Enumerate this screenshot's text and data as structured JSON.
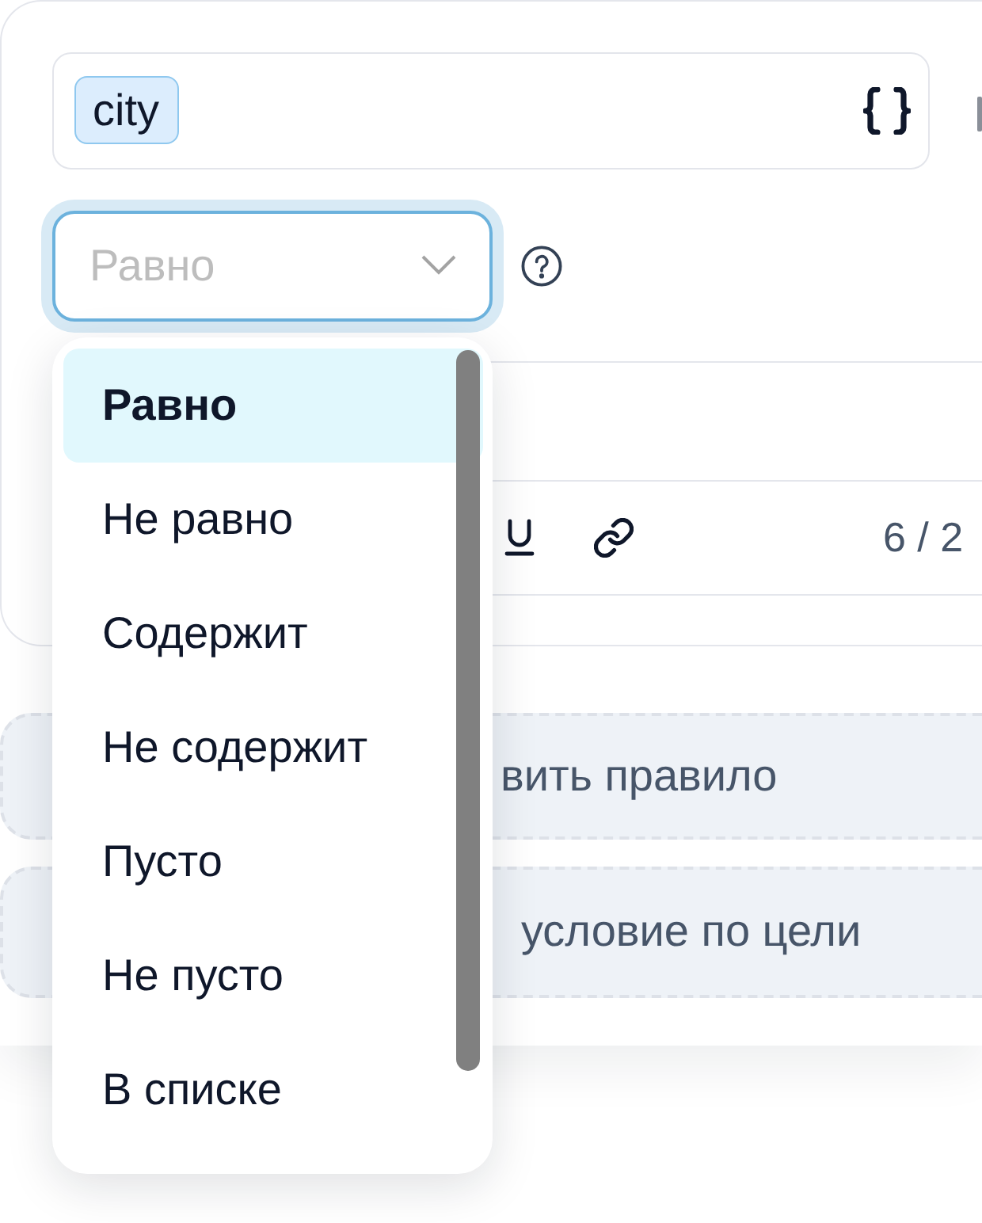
{
  "rule": {
    "field": {
      "tokens": [
        {
          "label": "city"
        }
      ]
    },
    "operator": {
      "placeholder": "Равно",
      "open": true,
      "options": [
        {
          "label": "Равно",
          "selected": true
        },
        {
          "label": "Не равно",
          "selected": false
        },
        {
          "label": "Содержит",
          "selected": false
        },
        {
          "label": "Не содержит",
          "selected": false
        },
        {
          "label": "Пусто",
          "selected": false
        },
        {
          "label": "Не пусто",
          "selected": false
        },
        {
          "label": "В списке",
          "selected": false
        }
      ]
    },
    "editor": {
      "counter": "6 / 2"
    }
  },
  "actions": [
    {
      "label": "вить правило"
    },
    {
      "label": "условие по цели"
    }
  ]
}
